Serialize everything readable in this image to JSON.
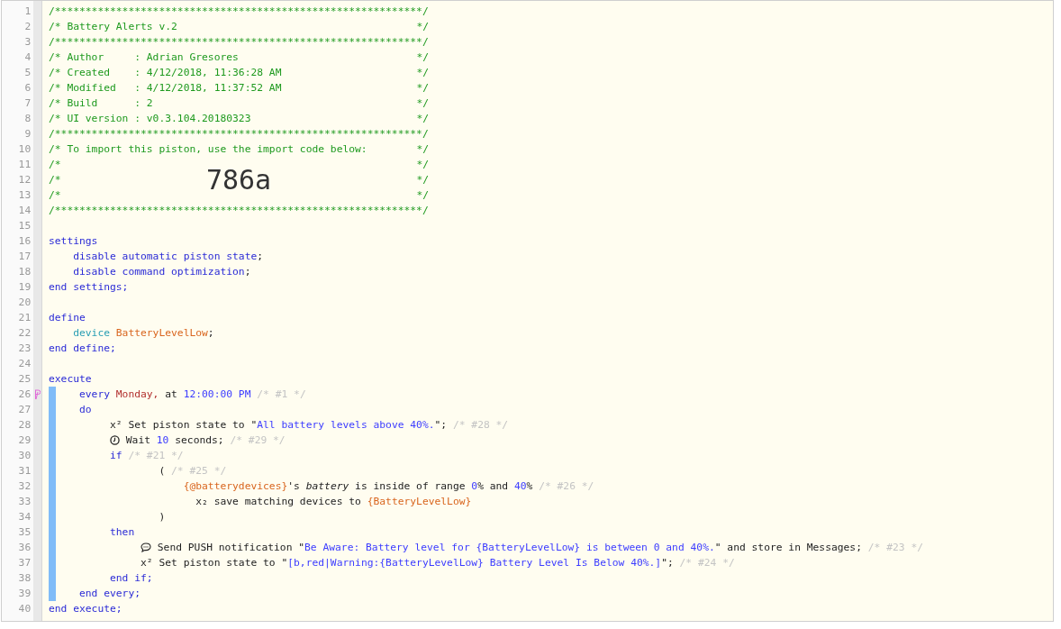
{
  "lines": [
    {
      "number": "1",
      "highlighted": false,
      "marked": false,
      "kind": "frame",
      "tokens": [
        {
          "text": "/************************************************************/",
          "kind": "comment"
        }
      ]
    },
    {
      "number": "2",
      "highlighted": false,
      "marked": false,
      "kind": "frame",
      "tokens": [
        {
          "text": "/* Battery Alerts v.2",
          "kind": "comment"
        },
        {
          "text": "*/",
          "kind": "comment"
        }
      ]
    },
    {
      "number": "3",
      "highlighted": false,
      "marked": false,
      "kind": "frame",
      "tokens": [
        {
          "text": "/************************************************************/",
          "kind": "comment"
        }
      ]
    },
    {
      "number": "4",
      "highlighted": false,
      "marked": false,
      "kind": "frame",
      "tokens": [
        {
          "text": "/* Author     : Adrian Gresores",
          "kind": "comment"
        },
        {
          "text": "*/",
          "kind": "comment"
        }
      ]
    },
    {
      "number": "5",
      "highlighted": false,
      "marked": false,
      "kind": "frame",
      "tokens": [
        {
          "text": "/* Created    : 4/12/2018, 11:36:28 AM",
          "kind": "comment"
        },
        {
          "text": "*/",
          "kind": "comment"
        }
      ]
    },
    {
      "number": "6",
      "highlighted": false,
      "marked": false,
      "kind": "frame",
      "tokens": [
        {
          "text": "/* Modified   : 4/12/2018, 11:37:52 AM",
          "kind": "comment"
        },
        {
          "text": "*/",
          "kind": "comment"
        }
      ]
    },
    {
      "number": "7",
      "highlighted": false,
      "marked": false,
      "kind": "frame",
      "tokens": [
        {
          "text": "/* Build      : 2",
          "kind": "comment"
        },
        {
          "text": "*/",
          "kind": "comment"
        }
      ]
    },
    {
      "number": "8",
      "highlighted": false,
      "marked": false,
      "kind": "frame",
      "tokens": [
        {
          "text": "/* UI version : v0.3.104.20180323",
          "kind": "comment"
        },
        {
          "text": "*/",
          "kind": "comment"
        }
      ]
    },
    {
      "number": "9",
      "highlighted": false,
      "marked": false,
      "kind": "frame",
      "tokens": [
        {
          "text": "/************************************************************/",
          "kind": "comment"
        }
      ]
    },
    {
      "number": "10",
      "highlighted": false,
      "marked": false,
      "kind": "frame",
      "tokens": [
        {
          "text": "/* To import this piston, use the import code below:",
          "kind": "comment"
        },
        {
          "text": "*/",
          "kind": "comment"
        }
      ]
    },
    {
      "number": "11",
      "highlighted": false,
      "marked": false,
      "kind": "frame",
      "tokens": [
        {
          "text": "/*",
          "kind": "comment"
        },
        {
          "text": "*/",
          "kind": "comment"
        }
      ]
    },
    {
      "number": "12",
      "highlighted": false,
      "marked": false,
      "kind": "frame",
      "tokens": [
        {
          "text": "/*",
          "kind": "comment"
        },
        {
          "text": "786a",
          "kind": "big"
        },
        {
          "text": "*/",
          "kind": "comment"
        }
      ]
    },
    {
      "number": "13",
      "highlighted": false,
      "marked": false,
      "kind": "frame",
      "tokens": [
        {
          "text": "/*",
          "kind": "comment"
        },
        {
          "text": "*/",
          "kind": "comment"
        }
      ]
    },
    {
      "number": "14",
      "highlighted": false,
      "marked": false,
      "kind": "frame",
      "tokens": [
        {
          "text": "/************************************************************/",
          "kind": "comment"
        }
      ]
    },
    {
      "number": "15",
      "highlighted": false,
      "marked": false,
      "kind": "code"
    },
    {
      "number": "16",
      "highlighted": false,
      "marked": false,
      "kind": "code",
      "tokens": [
        {
          "text": "settings",
          "kind": "keyword"
        }
      ]
    },
    {
      "number": "17",
      "highlighted": false,
      "marked": false,
      "kind": "code",
      "tokens": [
        {
          "text": "    disable automatic piston state",
          "kind": "keyword"
        },
        {
          "text": ";",
          "kind": "plain"
        }
      ]
    },
    {
      "number": "18",
      "highlighted": false,
      "marked": false,
      "kind": "code",
      "tokens": [
        {
          "text": "    disable command optimization",
          "kind": "keyword"
        },
        {
          "text": ";",
          "kind": "plain"
        }
      ]
    },
    {
      "number": "19",
      "highlighted": false,
      "marked": false,
      "kind": "code",
      "tokens": [
        {
          "text": "end settings;",
          "kind": "keyword"
        }
      ]
    },
    {
      "number": "20",
      "highlighted": false,
      "marked": false,
      "kind": "code"
    },
    {
      "number": "21",
      "highlighted": false,
      "marked": false,
      "kind": "code",
      "tokens": [
        {
          "text": "define",
          "kind": "keyword"
        }
      ]
    },
    {
      "number": "22",
      "highlighted": false,
      "marked": false,
      "kind": "code",
      "tokens": [
        {
          "text": "    device",
          "kind": "type"
        },
        {
          "text": " BatteryLevelLow",
          "kind": "variable"
        },
        {
          "text": ";",
          "kind": "plain"
        }
      ]
    },
    {
      "number": "23",
      "highlighted": false,
      "marked": false,
      "kind": "code",
      "tokens": [
        {
          "text": "end define;",
          "kind": "keyword"
        }
      ]
    },
    {
      "number": "24",
      "highlighted": false,
      "marked": false,
      "kind": "code"
    },
    {
      "number": "25",
      "highlighted": false,
      "marked": false,
      "kind": "code",
      "tokens": [
        {
          "text": "execute",
          "kind": "keyword"
        }
      ]
    },
    {
      "number": "26",
      "highlighted": true,
      "marked": true,
      "kind": "code",
      "tokens": [
        {
          "text": "     every",
          "kind": "keyword"
        },
        {
          "text": " Monday,",
          "kind": "day"
        },
        {
          "text": " at ",
          "kind": "plain"
        },
        {
          "text": "12:00:00 PM",
          "kind": "number"
        },
        {
          "text": " /* #1 */",
          "kind": "note"
        }
      ]
    },
    {
      "number": "27",
      "highlighted": true,
      "marked": false,
      "kind": "code",
      "tokens": [
        {
          "text": "     do",
          "kind": "keyword"
        }
      ]
    },
    {
      "number": "28",
      "highlighted": true,
      "marked": false,
      "kind": "code",
      "tokens": [
        {
          "text": "          x²",
          "kind": "plain"
        },
        {
          "text": " Set piston state to \"",
          "kind": "plain"
        },
        {
          "text": "All battery levels above 40%.",
          "kind": "string"
        },
        {
          "text": "\"; ",
          "kind": "plain"
        },
        {
          "text": "/* #28 */",
          "kind": "note"
        }
      ]
    },
    {
      "number": "29",
      "highlighted": true,
      "marked": false,
      "kind": "code",
      "tokens": [
        {
          "kind": "clock"
        },
        {
          "text": " Wait ",
          "kind": "plain"
        },
        {
          "text": "10",
          "kind": "number"
        },
        {
          "text": " seconds; ",
          "kind": "plain"
        },
        {
          "text": "/* #29 */",
          "kind": "note"
        }
      ]
    },
    {
      "number": "30",
      "highlighted": true,
      "marked": false,
      "kind": "code",
      "tokens": [
        {
          "text": "          if",
          "kind": "keyword"
        },
        {
          "text": " /* #21 */",
          "kind": "note"
        }
      ]
    },
    {
      "number": "31",
      "highlighted": true,
      "marked": false,
      "kind": "code",
      "tokens": [
        {
          "text": "                  (",
          "kind": "plain"
        },
        {
          "text": " /* #25 */",
          "kind": "note"
        }
      ]
    },
    {
      "number": "32",
      "highlighted": true,
      "marked": false,
      "kind": "code",
      "tokens": [
        {
          "text": "                      {@batterydevices}",
          "kind": "variable"
        },
        {
          "text": "'s ",
          "kind": "plain"
        },
        {
          "text": "battery",
          "kind": "italic"
        },
        {
          "text": " is inside of range ",
          "kind": "plain"
        },
        {
          "text": "0",
          "kind": "number"
        },
        {
          "text": "% and ",
          "kind": "plain"
        },
        {
          "text": "40",
          "kind": "number"
        },
        {
          "text": "% ",
          "kind": "plain"
        },
        {
          "text": "/* #26 */",
          "kind": "note"
        }
      ]
    },
    {
      "number": "33",
      "highlighted": true,
      "marked": false,
      "kind": "code",
      "tokens": [
        {
          "text": "                        x₂",
          "kind": "plain"
        },
        {
          "text": " save matching devices to ",
          "kind": "plain"
        },
        {
          "text": "{BatteryLevelLow}",
          "kind": "variable"
        }
      ]
    },
    {
      "number": "34",
      "highlighted": true,
      "marked": false,
      "kind": "code",
      "tokens": [
        {
          "text": "                  )",
          "kind": "plain"
        }
      ]
    },
    {
      "number": "35",
      "highlighted": true,
      "marked": false,
      "kind": "code",
      "tokens": [
        {
          "text": "          then",
          "kind": "keyword"
        }
      ]
    },
    {
      "number": "36",
      "highlighted": true,
      "marked": false,
      "kind": "code",
      "tokens": [
        {
          "kind": "speech"
        },
        {
          "text": " Send PUSH notification \"",
          "kind": "plain"
        },
        {
          "text": "Be Aware: Battery level for {BatteryLevelLow} is between 0 and 40%.",
          "kind": "string"
        },
        {
          "text": "\" and store in Messages; ",
          "kind": "plain"
        },
        {
          "text": "/* #23 */",
          "kind": "note"
        }
      ]
    },
    {
      "number": "37",
      "highlighted": true,
      "marked": false,
      "kind": "code",
      "tokens": [
        {
          "text": "               x²",
          "kind": "plain"
        },
        {
          "text": " Set piston state to \"",
          "kind": "plain"
        },
        {
          "text": "[b,red|Warning:{BatteryLevelLow} Battery Level Is Below 40%.]",
          "kind": "string"
        },
        {
          "text": "\"; ",
          "kind": "plain"
        },
        {
          "text": "/* #24 */",
          "kind": "note"
        }
      ]
    },
    {
      "number": "38",
      "highlighted": true,
      "marked": false,
      "kind": "code",
      "tokens": [
        {
          "text": "          end if;",
          "kind": "keyword"
        }
      ]
    },
    {
      "number": "39",
      "highlighted": true,
      "marked": false,
      "kind": "code",
      "tokens": [
        {
          "text": "     end every;",
          "kind": "keyword"
        }
      ]
    },
    {
      "number": "40",
      "highlighted": false,
      "marked": false,
      "kind": "code",
      "tokens": [
        {
          "text": "end execute;",
          "kind": "keyword"
        }
      ]
    }
  ]
}
